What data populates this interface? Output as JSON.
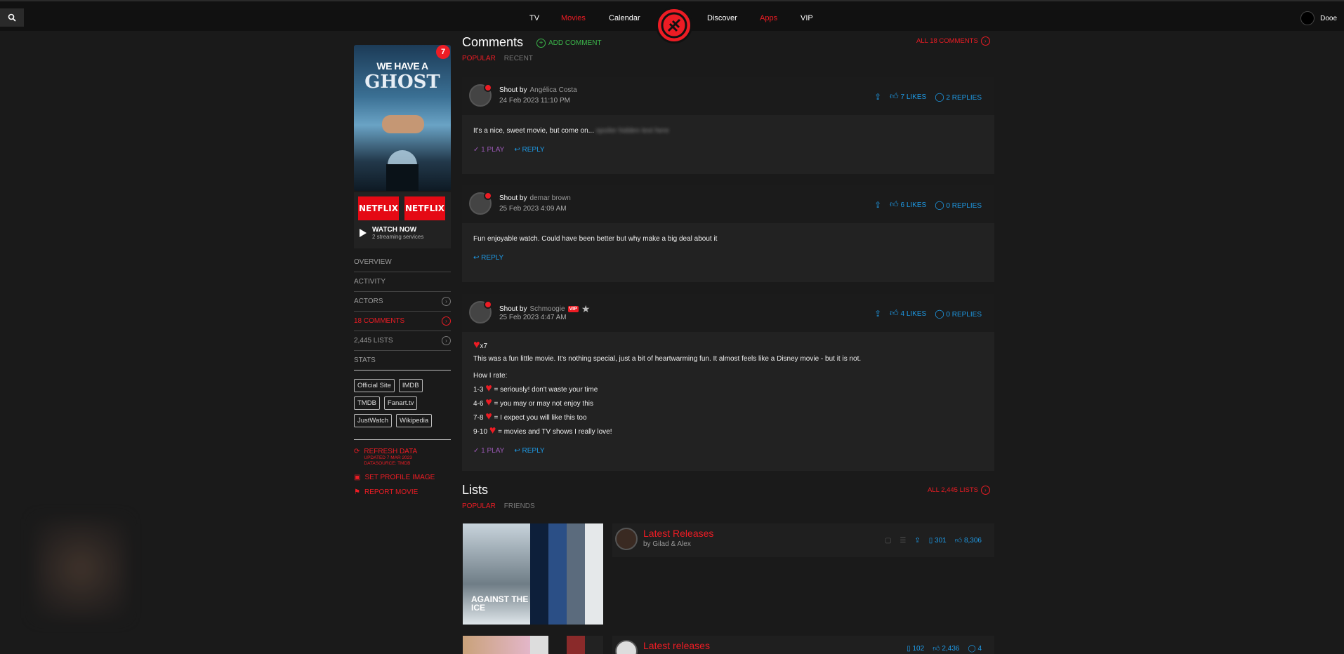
{
  "nav": {
    "items": [
      {
        "label": "TV",
        "active": false
      },
      {
        "label": "Movies",
        "active": true
      },
      {
        "label": "Calendar",
        "active": false
      },
      {
        "label": "Discover",
        "active": false
      },
      {
        "label": "Apps",
        "active": true
      },
      {
        "label": "VIP",
        "active": false
      }
    ],
    "user_name": "Dooe",
    "accent": "#ed1c24"
  },
  "movie": {
    "poster_line1": "WE HAVE A",
    "poster_line2": "GHOST",
    "rating_badge": "7",
    "streaming": [
      "NETFLIX",
      "NETFLIX"
    ],
    "watch_now": "WATCH NOW",
    "watch_sub": "2 streaming services"
  },
  "sidebar": {
    "items": [
      {
        "label": "OVERVIEW"
      },
      {
        "label": "ACTIVITY"
      },
      {
        "label": "ACTORS"
      },
      {
        "label": "18 COMMENTS"
      },
      {
        "label": "2,445 LISTS"
      },
      {
        "label": "STATS"
      }
    ],
    "links": [
      "Official Site",
      "IMDB",
      "TMDB",
      "Fanart.tv",
      "JustWatch",
      "Wikipedia"
    ],
    "refresh": "REFRESH DATA",
    "updated": "UPDATED 7 MAR 2023",
    "datasource": "DATASOURCE: TMDB",
    "set_profile": "SET PROFILE IMAGE",
    "report": "REPORT MOVIE"
  },
  "comments": {
    "title": "Comments",
    "add": "ADD COMMENT",
    "all": "ALL 18 COMMENTS",
    "tabs": [
      "POPULAR",
      "RECENT"
    ],
    "shout_prefix": "Shout by",
    "reply_label": "REPLY",
    "items": [
      {
        "author": "Angélica Costa",
        "date": "24 Feb 2023 11:10 PM",
        "likes": "7 LIKES",
        "replies": "2 REPLIES",
        "text": "It's a nice, sweet movie, but come on...",
        "plays": "1 PLAY"
      },
      {
        "author": "demar brown",
        "date": "25 Feb 2023 4:09 AM",
        "likes": "6 LIKES",
        "replies": "0 REPLIES",
        "text": "Fun enjoyable watch. Could have been better but why make a big deal about it"
      },
      {
        "author": "Schmoogie",
        "vip": "VIP",
        "date": "25 Feb 2023 4:47 AM",
        "likes": "4 LIKES",
        "replies": "0 REPLIES",
        "rating": "x7",
        "text": "This was a fun little movie. It's nothing special, just a bit of heartwarming fun. It almost feels like a Disney movie - but it is not.",
        "rate_title": "How I rate:",
        "rate_lines": [
          {
            "range": "1-3",
            "desc": "= seriously! don't waste your time"
          },
          {
            "range": "4-6",
            "desc": "= you may or may not enjoy this"
          },
          {
            "range": "7-8",
            "desc": "= I expect you will like this too"
          },
          {
            "range": "9-10",
            "desc": "= movies and TV shows I really love!"
          }
        ],
        "plays": "1 PLAY"
      }
    ]
  },
  "lists": {
    "title": "Lists",
    "all": "ALL 2,445 LISTS",
    "tabs": [
      "POPULAR",
      "FRIENDS"
    ],
    "items": [
      {
        "name": "Latest Releases",
        "by": "by Gilad & Alex",
        "items_count": "301",
        "likes": "8,306",
        "thumb_text": "AGAINST THE ICE"
      },
      {
        "name": "Latest releases",
        "items_count": "102",
        "likes": "2,436",
        "comments": "4"
      }
    ]
  }
}
